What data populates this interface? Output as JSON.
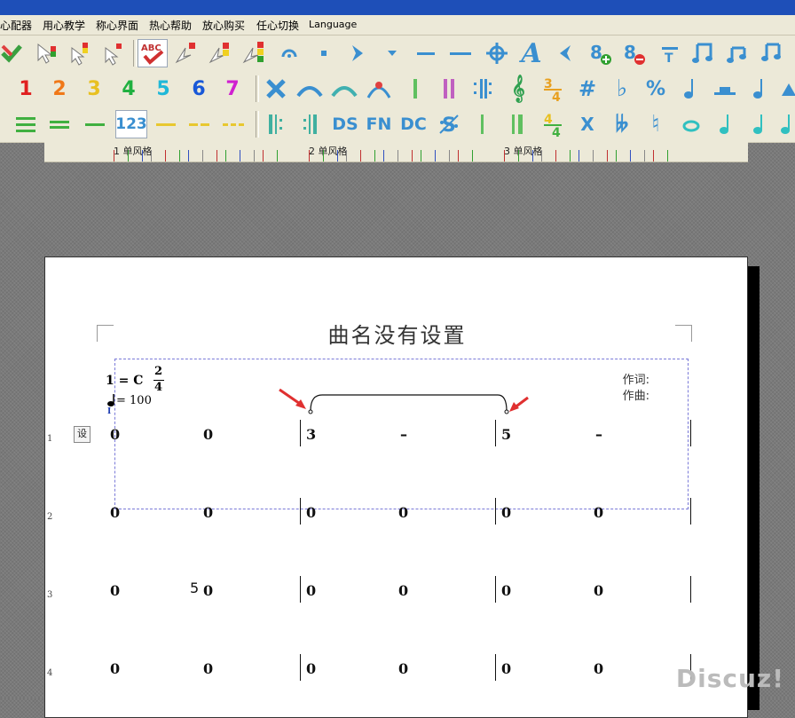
{
  "menu": [
    "心配器",
    "用心教学",
    "称心界面",
    "热心帮助",
    "放心购买",
    "任心切换",
    "Language"
  ],
  "toolbar1": {
    "icons": [
      "check-cross-icon",
      "arrow-cursor-icon",
      "arrow-cursor-color-icon",
      "arrow-cursor-red-icon",
      "spellcheck-icon",
      "cursor-red-icon",
      "cursor-yellow-icon",
      "cursor-traffic-icon",
      "fermata-icon",
      "dot-icon",
      "chevron-right-icon",
      "triangle-down-icon",
      "dash-short-icon",
      "dash-long-icon",
      "crosshair-icon",
      "text-a-icon",
      "angle-left-icon",
      "add-note-icon",
      "remove-note-icon",
      "tuplet-bar-icon",
      "eighth-notes-icon",
      "beamed-notes-icon",
      "beamed-notes-2-icon"
    ]
  },
  "toolbar2": {
    "digits": [
      "1",
      "2",
      "3",
      "4",
      "5",
      "6",
      "7"
    ],
    "digit_colors": [
      "#e02020",
      "#f07818",
      "#e8c020",
      "#20b040",
      "#20b8d8",
      "#1858d8",
      "#d020d0"
    ],
    "icons": [
      "cross-x-icon",
      "slur-icon",
      "tie-icon",
      "breath-mark-icon",
      "barline-single-icon",
      "barline-double-icon",
      "repeat-icon",
      "treble-clef-icon",
      "time-sig-icon",
      "sharp-icon",
      "flat-icon",
      "natural-percent-icon",
      "quarter-note-icon",
      "whole-rest-icon",
      "eighth-note-icon",
      "triangle-icon"
    ]
  },
  "toolbar3": {
    "icons": [
      "lines-3-icon",
      "lines-2-icon",
      "line-1-icon",
      "numbered-123-icon",
      "line-yellow-icon",
      "dashed-yellow-icon",
      "dashed-yellow-2-icon",
      "repeat-start-icon",
      "repeat-end-icon",
      "ds-icon",
      "fn-icon",
      "dc-icon",
      "segno-icon",
      "barline-thin-icon",
      "barline-thick-icon",
      "time-sig-yellow-icon",
      "x-icon",
      "double-flat-icon",
      "natural-icon",
      "whole-note-icon",
      "quarter-note-icon",
      "eighth-note-icon",
      "sixteenth-note-icon"
    ],
    "labels": {
      "numbered": "123",
      "ds": "DS",
      "fn": "FN",
      "dc": "DC",
      "x": "X"
    }
  },
  "ruler": {
    "labels": [
      "1 单风格",
      "2 单风格",
      "3 单风格"
    ]
  },
  "score": {
    "title": "曲名没有设置",
    "key": "1 = C",
    "time_sig_top": "2",
    "time_sig_bottom": "4",
    "tempo": "= 100",
    "lyricist_label": "作词:",
    "composer_label": "作曲:",
    "set_button": "设",
    "rows": [
      {
        "num": "1",
        "notes": [
          "0",
          "0",
          "3",
          "–",
          "5",
          "–"
        ]
      },
      {
        "num": "2",
        "notes": [
          "0",
          "0",
          "0",
          "0",
          "0",
          "0"
        ]
      },
      {
        "num": "3",
        "notes": [
          "0",
          "0",
          "0",
          "0",
          "0",
          "0"
        ],
        "extra": "5"
      },
      {
        "num": "4",
        "notes": [
          "0",
          "0",
          "0",
          "0",
          "0",
          "0"
        ]
      }
    ]
  },
  "watermark": "Discuz!"
}
